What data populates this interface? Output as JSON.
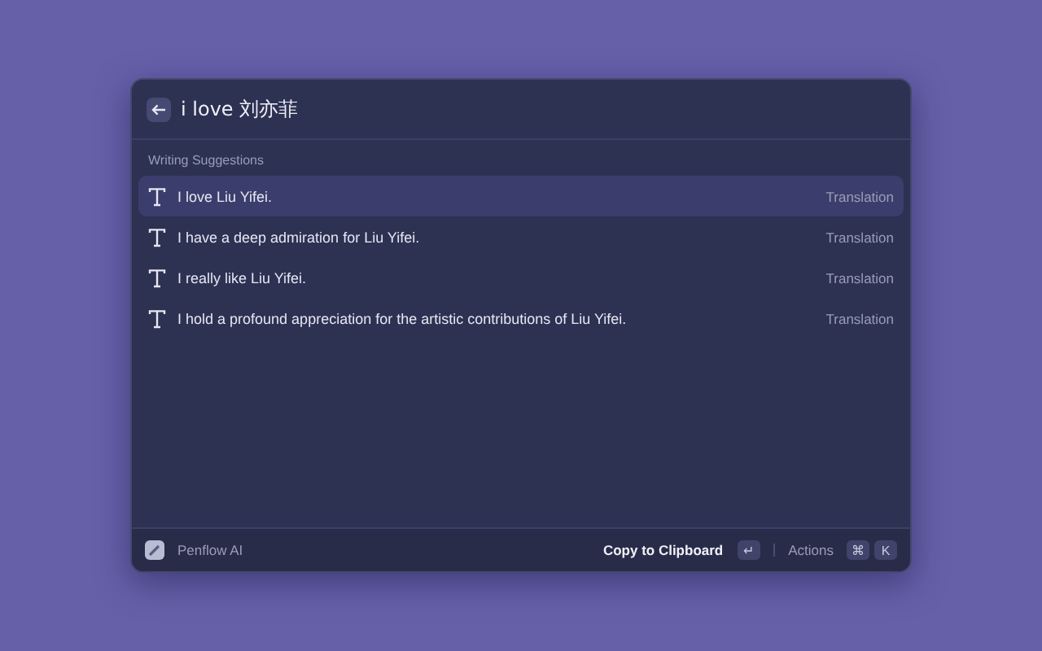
{
  "search": {
    "value": "i love 刘亦菲"
  },
  "section_title": "Writing Suggestions",
  "suggestions": [
    {
      "text": "I love Liu Yifei.",
      "tag": "Translation",
      "selected": true
    },
    {
      "text": "I have a deep admiration for Liu Yifei.",
      "tag": "Translation",
      "selected": false
    },
    {
      "text": "I really like Liu Yifei.",
      "tag": "Translation",
      "selected": false
    },
    {
      "text": "I hold a profound appreciation for the artistic contributions of Liu Yifei.",
      "tag": "Translation",
      "selected": false
    }
  ],
  "footer": {
    "app_name": "Penflow AI",
    "primary_action": "Copy to Clipboard",
    "primary_key": "↵",
    "actions_label": "Actions",
    "action_keys": [
      "⌘",
      "K"
    ]
  }
}
